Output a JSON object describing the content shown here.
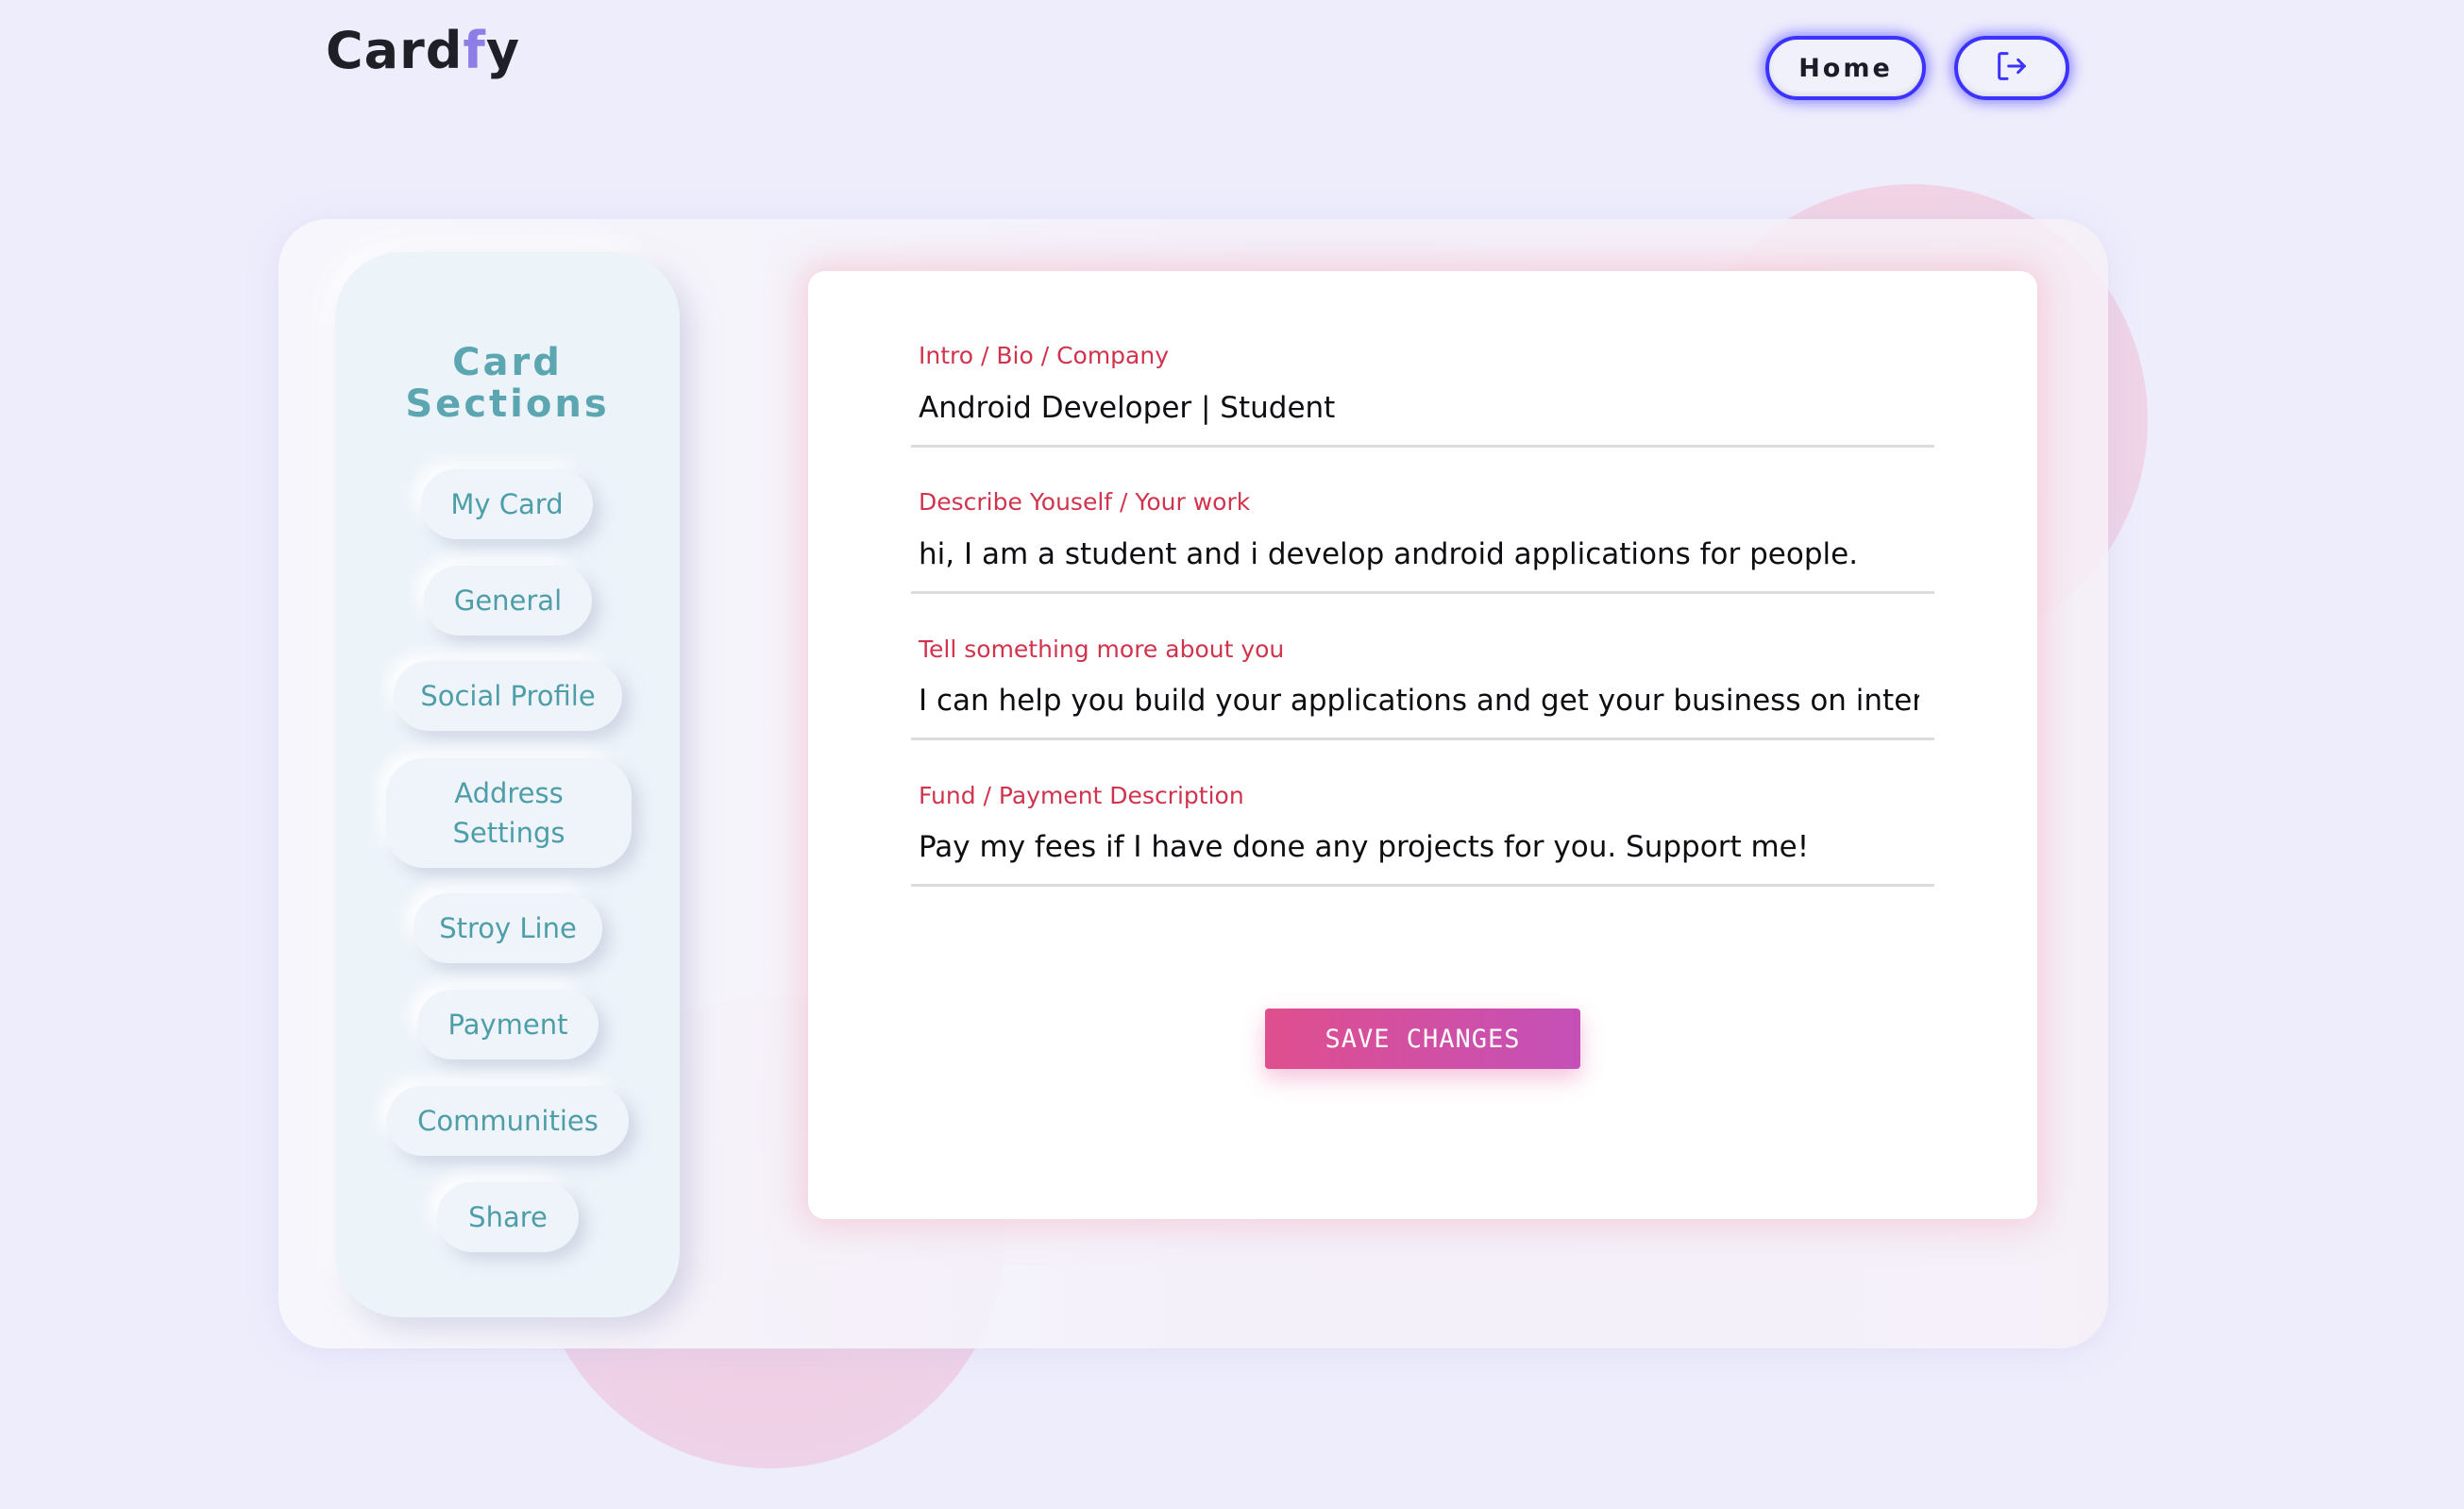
{
  "header": {
    "logo_main": "Card",
    "logo_accent": "f",
    "logo_end": "y",
    "home_label": "Home",
    "logout_icon": "logout-icon"
  },
  "sidebar": {
    "title_line1": "Card",
    "title_line2": "Sections",
    "items": [
      {
        "label": "My Card"
      },
      {
        "label": "General"
      },
      {
        "label": "Social Profile"
      },
      {
        "label": "Address"
      },
      {
        "label": "Settings"
      },
      {
        "label": "Stroy Line"
      },
      {
        "label": "Payment"
      },
      {
        "label": "Communities"
      },
      {
        "label": "Share"
      }
    ]
  },
  "form": {
    "fields": [
      {
        "label": "Intro / Bio / Company",
        "value": "Android Developer | Student"
      },
      {
        "label": "Describe Youself / Your work",
        "value": "hi, I am a student and i develop android applications for people."
      },
      {
        "label": "Tell something more about you",
        "value": "I can help you build your applications and get your business on internet. I cc"
      },
      {
        "label": "Fund / Payment Description",
        "value": "Pay my fees if I have done any projects for you. Support me!"
      }
    ],
    "save_label": "SAVE CHANGES"
  },
  "colors": {
    "background": "#eeedfc",
    "accent_blue": "#3c33ff",
    "sidebar_text": "#4e9ea9",
    "label_red": "#d0344d",
    "save_gradient_start": "#df4f8e",
    "save_gradient_end": "#c450b8"
  }
}
